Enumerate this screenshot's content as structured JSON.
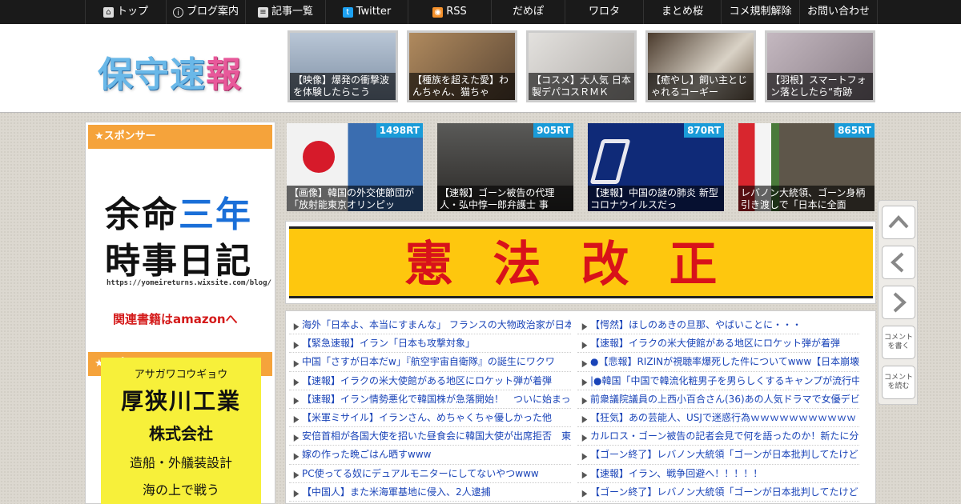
{
  "nav": {
    "items": [
      {
        "label": "トップ",
        "icon": "home-icon"
      },
      {
        "label": "ブログ案内",
        "icon": "info-icon"
      },
      {
        "label": "記事一覧",
        "icon": "list-icon"
      },
      {
        "label": "Twitter",
        "icon": "twitter-icon"
      },
      {
        "label": "RSS",
        "icon": "rss-icon"
      },
      {
        "label": "だめぽ",
        "icon": ""
      },
      {
        "label": "ワロタ",
        "icon": ""
      },
      {
        "label": "まとめ桜",
        "icon": ""
      },
      {
        "label": "コメ規制解除",
        "icon": ""
      },
      {
        "label": "お問い合わせ",
        "icon": ""
      }
    ]
  },
  "header": {
    "logo_main": "保守速",
    "logo_accent": "報",
    "thumbs": [
      {
        "caption": "【映像】爆発の衝撃波を体験したらこう",
        "color": "#8fa2b8"
      },
      {
        "caption": "【種族を超えた愛】わんちゃん、猫ちゃ",
        "color": "#8a6a4a"
      },
      {
        "caption": "【コスメ】大人気 日本製デパコスＲＭＫ",
        "color": "#c9c6c2"
      },
      {
        "caption": "【癒やし】飼い主とじゃれるコーギー",
        "color": "#6b5a48"
      },
      {
        "caption": "【羽根】スマートフォン落としたら“奇跡",
        "color": "#a79aa4"
      }
    ]
  },
  "sidebar": {
    "sponsor_label_1": "★スポンサー",
    "sponsor_label_2": "★スポンサー",
    "ad1": {
      "line1_a": "余命",
      "line1_b": "三年",
      "line2": "時事日記",
      "url": "https://yomeireturns.wixsite.com/blog/",
      "cta": "関連書籍はamazonへ"
    },
    "ad2": {
      "kana": "アサガワコウギョウ",
      "name": "厚狭川工業",
      "corp": "株式会社",
      "desc": "造船・外艤装設計",
      "more": "海の上で戦う"
    }
  },
  "rt_items": [
    {
      "badge": "1498RT",
      "caption": "【画像】韓国の外交使節団が「放射能東京オリンピッ",
      "color": "#3a5c8a"
    },
    {
      "badge": "905RT",
      "caption": "【速報】ゴーン被告の代理人・弘中惇一郎弁護士 事",
      "color": "#3c3a36"
    },
    {
      "badge": "870RT",
      "caption": "【速報】中国の謎の肺炎 新型コロナウイルスだっ",
      "color": "#1a3a8a"
    },
    {
      "badge": "865RT",
      "caption": "レバノン大統領、ゴーン身柄引き渡しで「日本に全面",
      "color": "#5a5448"
    }
  ],
  "banner": {
    "text": "憲法改正"
  },
  "links_left": [
    "海外「日本よ、本当にすまんな」 フランスの大物政治家が日本",
    "【緊急速報】イラン「日本も攻撃対象」",
    "中国「さすが日本だw」『航空宇宙自衛隊』の誕生にワクワ",
    "【速報】イラクの米大使館がある地区にロケット弾が着弾",
    "【速報】イラン情勢悪化で韓国株が急落開始！　ついに始まっ",
    "【米軍ミサイル】イランさん、めちゃくちゃ優しかった他",
    "安倍首相が各国大使を招いた昼食会に韓国大使が出席拒否　東",
    "嫁の作った晩ごはん晒すwww",
    "PC使ってる奴にデュアルモニターにしてないやつwww",
    "【中国人】また米海軍基地に侵入、2人逮捕"
  ],
  "links_right": [
    "【愕然】ほしのあきの旦那、やばいことに・・・",
    "【速報】イラクの米大使館がある地区にロケット弾が着弾",
    "●【悲報】RIZINが視聴率爆死した件についてwww【日本崩壊】",
    "|●韓国「中国で韓流化粧男子を男らしくするキャンプが流行中",
    "前衆議院議員の上西小百合さん(36)あの人気ドラマで女優デビ",
    "【狂気】あの芸能人、USJで迷惑行為ｗｗｗｗｗｗｗｗｗｗｗ",
    "カルロス・ゴーン被告の記者会見で何を語ったのか！新たに分",
    "【ゴーン終了】レバノン大統領「ゴーンが日本批判してたけど",
    "【速報】イラン、戦争回避へ！！！！！",
    "【ゴーン終了】レバノン大統領「ゴーンが日本批判してたけど"
  ],
  "side_buttons": {
    "comment_write": "コメントを書く",
    "comment_read": "コメントを読む"
  }
}
